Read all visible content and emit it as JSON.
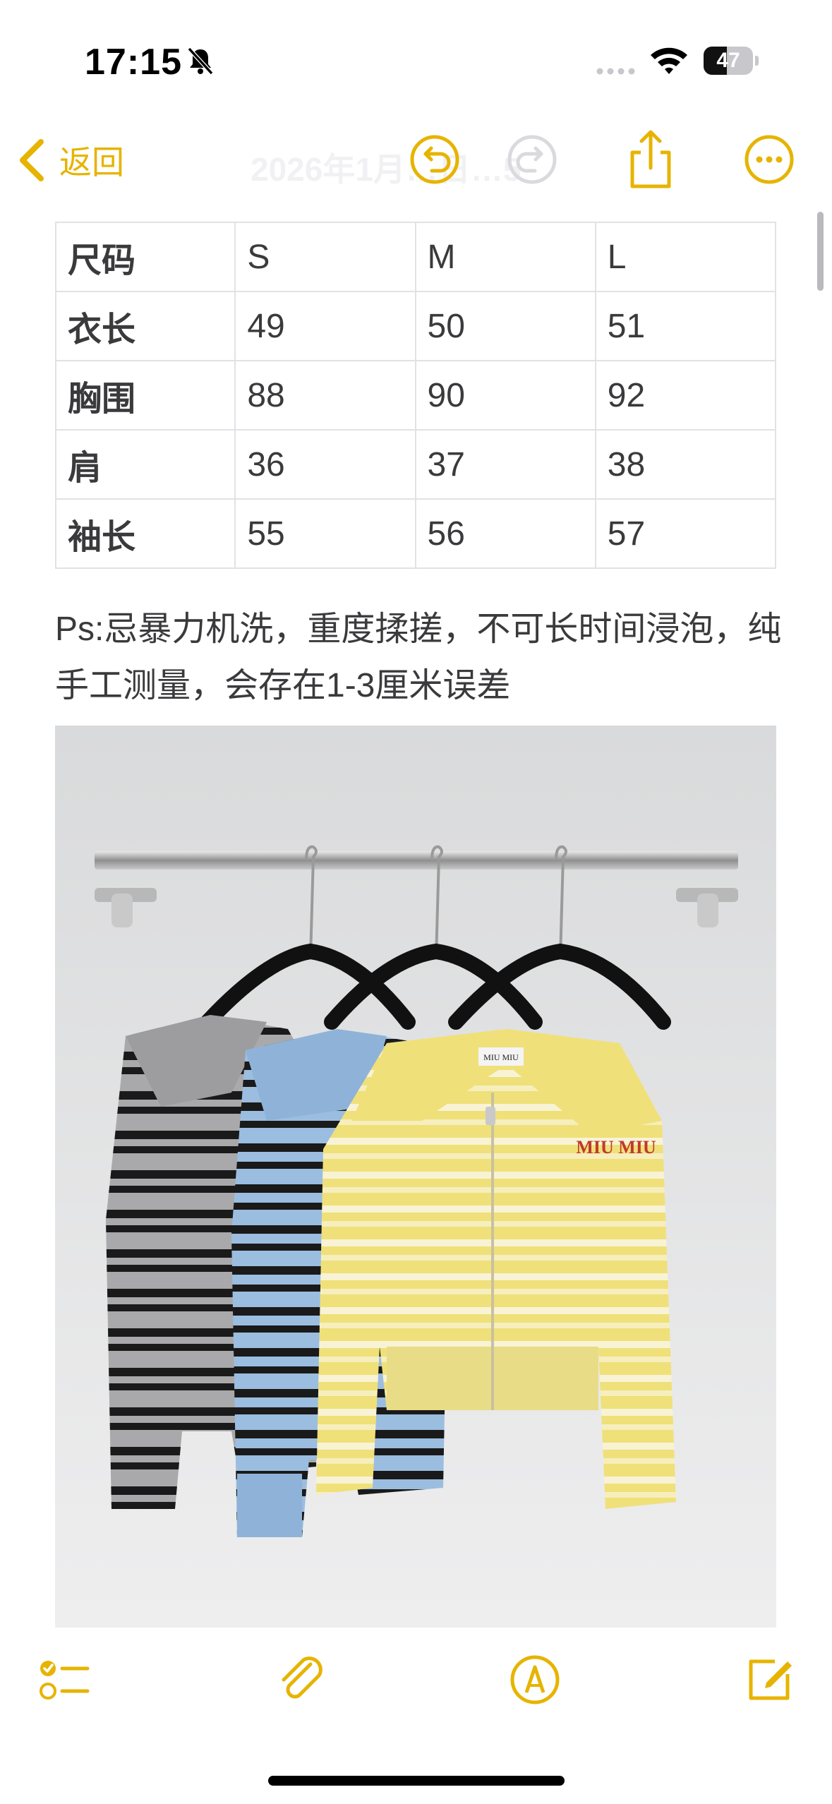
{
  "status_bar": {
    "time": "17:15",
    "battery": "47",
    "battery_level": 0.47
  },
  "nav": {
    "back_label": "返回",
    "title": "2026年1月…日…5"
  },
  "table": {
    "rows": [
      [
        "尺码",
        "S",
        "M",
        "L"
      ],
      [
        "衣长",
        "49",
        "50",
        "51"
      ],
      [
        "胸围",
        "88",
        "90",
        "92"
      ],
      [
        "肩",
        "36",
        "37",
        "38"
      ],
      [
        "袖长",
        "55",
        "56",
        "57"
      ]
    ]
  },
  "note": {
    "text": "Ps:忌暴力机洗，重度揉搓，不可长时间浸泡，纯手工测量，会存在1-3厘米误差"
  },
  "photo": {
    "label_text": "MIU MIU"
  },
  "colors": {
    "accent": "#e6b400",
    "text": "#3a3a3c",
    "table_border": "#e2e2e6"
  },
  "icons": [
    "mute-icon",
    "wifi-icon",
    "battery-icon",
    "chevron-left-icon",
    "undo-icon",
    "redo-icon",
    "share-icon",
    "more-icon",
    "checklist-icon",
    "paperclip-icon",
    "markup-icon",
    "compose-icon"
  ]
}
